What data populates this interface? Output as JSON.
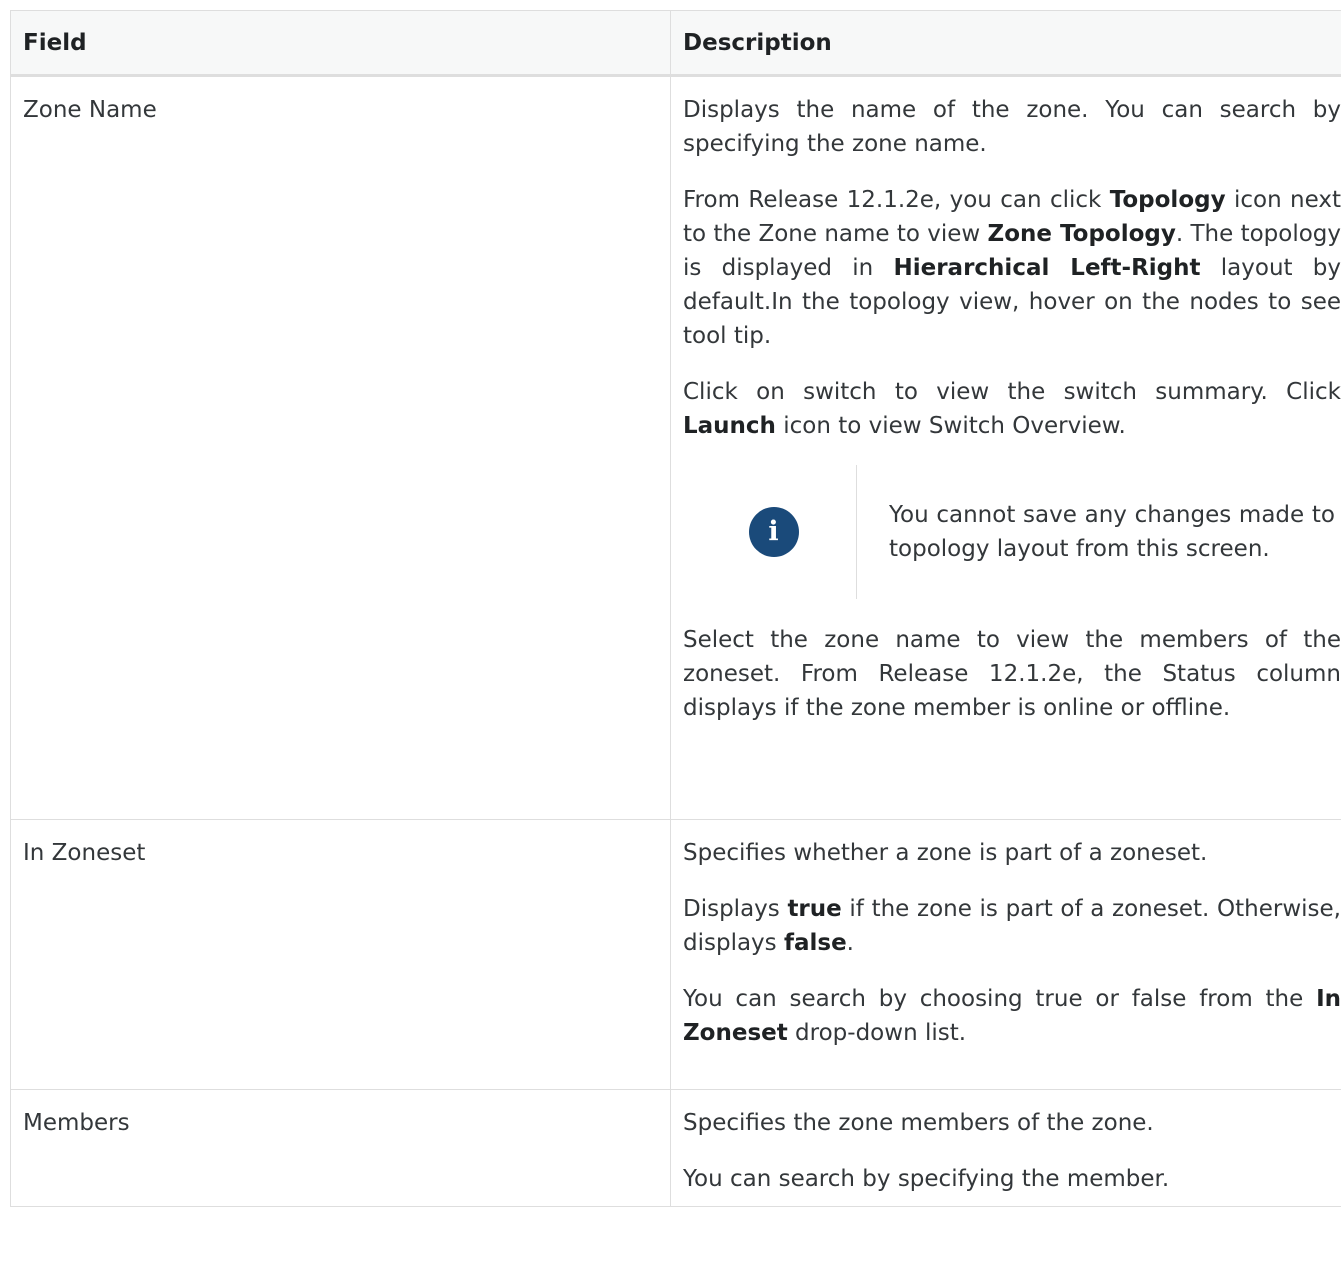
{
  "table": {
    "headers": [
      "Field",
      "Description"
    ],
    "rows": [
      {
        "field": "Zone Name",
        "p1": "Displays the name of the zone. You can search by specifying the zone name.",
        "p2_a": "From Release 12.1.2e, you can click ",
        "p2_b1": "Topology",
        "p2_c": " icon next to the Zone name to view ",
        "p2_b2": "Zone Topology",
        "p2_d": ". The topology is displayed in ",
        "p2_b3": "Hierarchical Left-Right",
        "p2_e": " layout by default.In the topology view, hover on the nodes to see tool tip.",
        "p3_a": "Click on switch to view the switch summary. Click ",
        "p3_b": "Launch",
        "p3_c": " icon to view Switch Overview.",
        "note_icon": "info-icon",
        "note": "You cannot save any changes made to topology layout from this screen.",
        "p4": "Select the zone name to view the members of the zoneset. From Release 12.1.2e, the Status column displays if the zone member is online or offline."
      },
      {
        "field": "In Zoneset",
        "p1": "Specifies whether a zone is part of a zoneset.",
        "p2_a": "Displays ",
        "p2_b1": "true",
        "p2_c": " if the zone is part of a zoneset. Otherwise, displays ",
        "p2_b2": "false",
        "p2_d": ".",
        "p3_a": "You can search by choosing true or false from the ",
        "p3_b": "In Zoneset",
        "p3_c": " drop-down list."
      },
      {
        "field": "Members",
        "p1": "Specifies the zone members of the zone.",
        "p2": "You can search by specifying the member."
      }
    ]
  }
}
